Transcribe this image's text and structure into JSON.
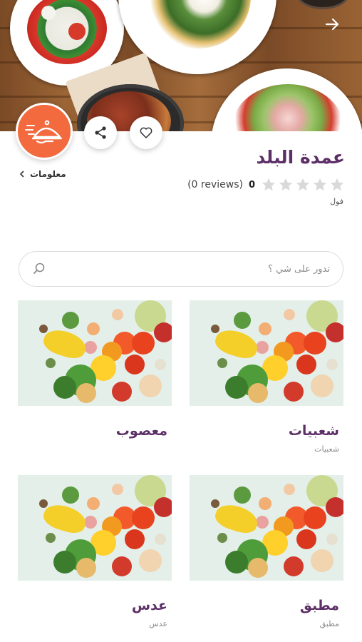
{
  "header": {
    "back_icon": "arrow-right-icon"
  },
  "actions": {
    "share_icon": "share-icon",
    "favorite_icon": "heart-icon",
    "logo_icon": "food-delivery-icon"
  },
  "restaurant": {
    "name": "عمدة البلد",
    "rating": "0",
    "reviews": "(0 reviews)",
    "subtitle": "فول",
    "info_link": "معلومات",
    "stars_filled": 0,
    "stars_total": 5
  },
  "search": {
    "placeholder": "تدور على شي ؟",
    "value": ""
  },
  "categories": [
    {
      "name": "شعبيات",
      "sub": "شعبيات"
    },
    {
      "name": "معصوب",
      "sub": ""
    },
    {
      "name": "مطبق",
      "sub": "مطبق"
    },
    {
      "name": "عدس",
      "sub": "عدس"
    }
  ],
  "colors": {
    "brand": "#5d2f67",
    "accent": "#f26a3d",
    "star_empty": "#d9d9d9"
  }
}
